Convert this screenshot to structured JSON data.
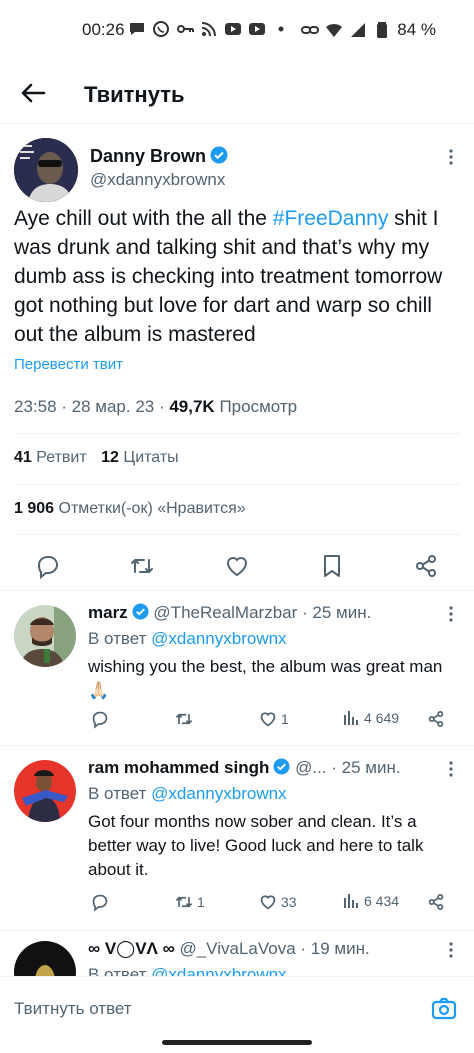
{
  "status_bar": {
    "time": "00:26",
    "battery": "84 %",
    "icons_left": [
      "chat-bubble-icon",
      "whatsapp-icon",
      "key-icon",
      "rss-icon",
      "youtube-icon",
      "youtube-icon",
      "dot-icon"
    ],
    "icons_right": [
      "link-icon",
      "wifi-icon",
      "signal-icon",
      "battery-icon"
    ]
  },
  "header": {
    "title": "Твитнуть"
  },
  "tweet": {
    "author_name": "Danny Brown",
    "author_handle": "@xdannyxbrownx",
    "text_before": "Aye chill out with the all the ",
    "hashtag": "#FreeDanny",
    "text_after": " shit I was drunk and talking shit and that’s why my dumb ass is checking into treatment tomorrow got nothing but love for dart and warp so chill out the album is mastered",
    "translate": "Перевести твит",
    "timestamp": "23:58 · 28 мар. 23 · ",
    "views_count": "49,7K",
    "views_label": " Просмотр",
    "retweets_count": "41",
    "retweets_label": " Ретвит",
    "quotes_count": "12",
    "quotes_label": " Цитаты",
    "likes_count": "1 906",
    "likes_label": " Отметки(-ок) «Нравится»"
  },
  "replies": [
    {
      "name": "marz",
      "handle": "@TheRealMarzbar",
      "time": " · 25 мин.",
      "reply_prefix": "В ответ ",
      "reply_to": "@xdannyxbrownx",
      "text": "wishing you the best, the album was great man 🙏🏻",
      "retweets": "",
      "likes": "1",
      "views": "4 649"
    },
    {
      "name": "ram mohammed singh",
      "handle": "@...",
      "time": " · 25 мин.",
      "reply_prefix": "В ответ ",
      "reply_to": "@xdannyxbrownx",
      "text": "Got four months now sober and clean. It’s a better way to live! Good luck and here to talk about it.",
      "retweets": "1",
      "likes": "33",
      "views": "6 434"
    },
    {
      "name": "∞ V◯VΛ ∞",
      "handle": "@_VivaLaVova",
      "time": " · 19 мин.",
      "reply_prefix": "В ответ ",
      "reply_to": "@xdannyxbrownx"
    }
  ],
  "compose": {
    "placeholder": "Твитнуть ответ"
  },
  "colors": {
    "accent": "#1d9bf0",
    "text": "#0f1419",
    "secondary": "#536471"
  }
}
